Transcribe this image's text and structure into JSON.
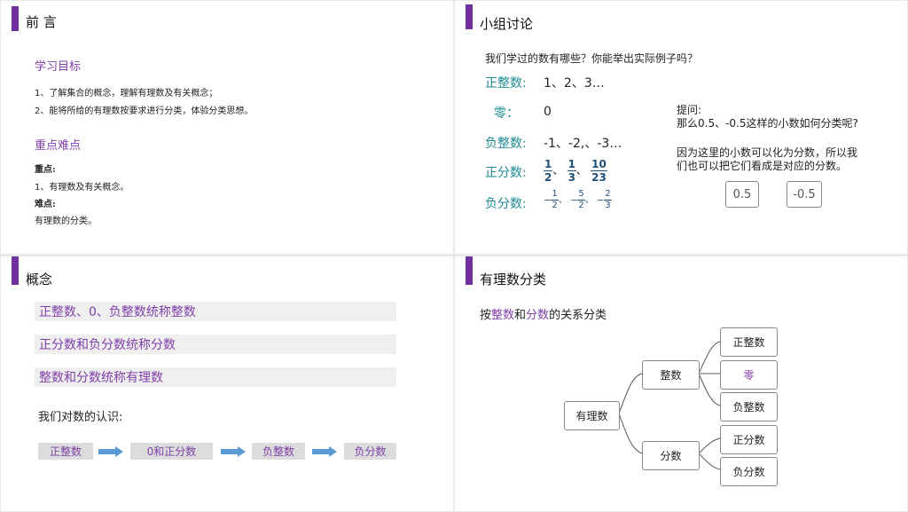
{
  "slide1": {
    "title": "前 言",
    "section1_heading": "学习目标",
    "goals": [
      "1、了解集合的概念，理解有理数及有关概念；",
      "2、能将所给的有理数按要求进行分类，体验分类思想。"
    ],
    "section2_heading": "重点难点",
    "key_label": "重点:",
    "key_text": "1、有理数及有关概念。",
    "hard_label": "难点:",
    "hard_text": "有理数的分类。"
  },
  "slide2": {
    "title": "小组讨论",
    "question": "我们学过的数有哪些？你能举出实际例子吗？",
    "rows": [
      {
        "label": "正整数:",
        "value": "1、2、3…"
      },
      {
        "label": "零：",
        "value": "0"
      },
      {
        "label": "负整数:",
        "value": "-1、-2,、-3…"
      },
      {
        "label": "正分数:",
        "fractions": [
          [
            "1",
            "2"
          ],
          [
            "1",
            "3"
          ],
          [
            "10",
            "23"
          ]
        ],
        "sep": "、"
      },
      {
        "label": "负分数:",
        "fractions": [
          [
            "1",
            "2"
          ],
          [
            "5",
            "2"
          ],
          [
            "2",
            "3"
          ]
        ],
        "sep": "、",
        "sign": "−"
      }
    ],
    "prompt_label": "提问:",
    "prompt_text": "那么0.5、-0.5这样的小数如何分类呢?",
    "answer_text_line1": "因为这里的小数可以化为分数，所以我",
    "answer_text_line2": "们也可以把它们看成是对应的分数。",
    "box1": "0.5",
    "box2": "-0.5"
  },
  "slide3": {
    "title": "概念",
    "facts": [
      "正整数、0、负整数统称整数",
      "正分数和负分数统称分数",
      "整数和分数统称有理数"
    ],
    "understanding": "我们对数的认识:",
    "flow": [
      "正整数",
      "0和正分数",
      "负整数",
      "负分数"
    ]
  },
  "slide4": {
    "title": "有理数分类",
    "subtitle_prefix": "按",
    "subtitle_w1": "整数",
    "subtitle_mid": "和",
    "subtitle_w2": "分数",
    "subtitle_suffix": "的关系分类",
    "root": "有理数",
    "integer": "整数",
    "fraction": "分数",
    "pos_int": "正整数",
    "zero": "零",
    "neg_int": "负整数",
    "pos_frac": "正分数",
    "neg_frac": "负分数"
  }
}
